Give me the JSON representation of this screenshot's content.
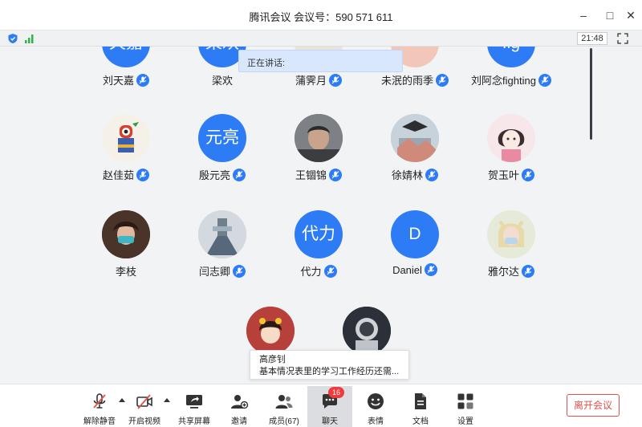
{
  "window": {
    "title": "腾讯会议 会议号：590 571 611",
    "minimize": "–",
    "maximize": "□",
    "close": "✕"
  },
  "status": {
    "time": "21:48"
  },
  "speaking": {
    "label": "正在讲话:"
  },
  "participants": [
    {
      "name": "刘天嘉",
      "avatar_text": "天嘉",
      "avatar_kind": "text"
    },
    {
      "name": "梁欢",
      "avatar_text": "梁欢",
      "avatar_kind": "text"
    },
    {
      "name": "蒲霁月",
      "avatar_text": "",
      "avatar_kind": "photo"
    },
    {
      "name": "未泯的雨季",
      "avatar_text": "",
      "avatar_kind": "photo"
    },
    {
      "name": "刘阿念fighting",
      "avatar_text": "fig",
      "avatar_kind": "text"
    },
    {
      "name": "赵佳茹",
      "avatar_text": "",
      "avatar_kind": "photo"
    },
    {
      "name": "殷元亮",
      "avatar_text": "元亮",
      "avatar_kind": "text"
    },
    {
      "name": "王锢锦",
      "avatar_text": "",
      "avatar_kind": "photo"
    },
    {
      "name": "徐婧林",
      "avatar_text": "",
      "avatar_kind": "photo"
    },
    {
      "name": "贺玉叶",
      "avatar_text": "",
      "avatar_kind": "photo"
    },
    {
      "name": "李枝",
      "avatar_text": "",
      "avatar_kind": "photo"
    },
    {
      "name": "闫志卿",
      "avatar_text": "",
      "avatar_kind": "photo"
    },
    {
      "name": "代力",
      "avatar_text": "代力",
      "avatar_kind": "text"
    },
    {
      "name": "Daniel",
      "avatar_text": "D",
      "avatar_kind": "text"
    },
    {
      "name": "雅尔达",
      "avatar_text": "",
      "avatar_kind": "photo"
    },
    {
      "name": "",
      "avatar_text": "",
      "avatar_kind": "photo"
    },
    {
      "name": "",
      "avatar_text": "",
      "avatar_kind": "photo"
    }
  ],
  "chat_popup": {
    "sender": "高彦钊",
    "message": "基本情况表里的学习工作经历还需..."
  },
  "toolbar": {
    "unmute": "解除静音",
    "start_video": "开启视频",
    "share_screen": "共享屏幕",
    "invite": "邀请",
    "members": "成员(67)",
    "chat": "聊天",
    "chat_badge": "16",
    "reactions": "表情",
    "docs": "文档",
    "settings": "设置",
    "leave": "离开会议"
  },
  "colors": {
    "accent": "#2d7cf6",
    "danger": "#e0524c",
    "badge": "#ef3b3b"
  }
}
